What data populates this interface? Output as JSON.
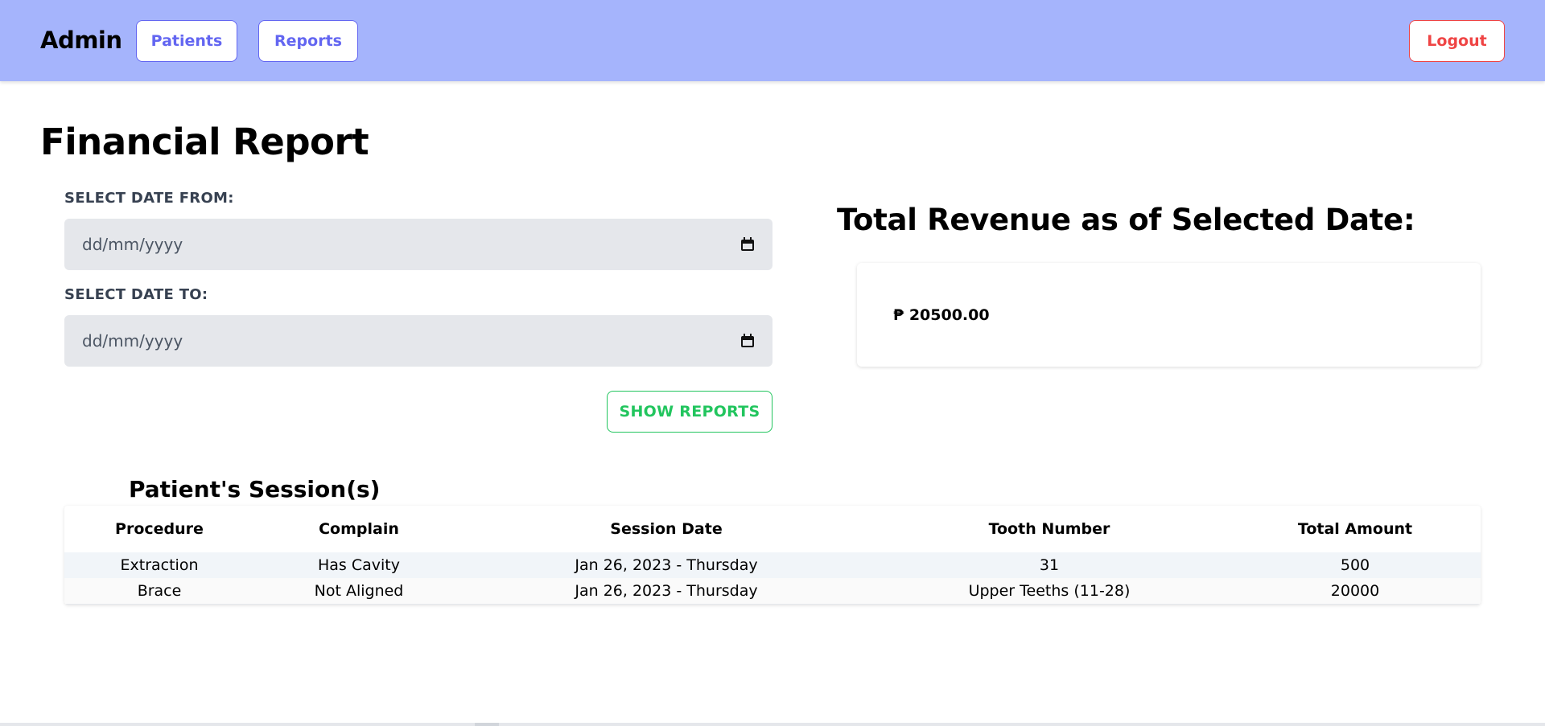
{
  "navbar": {
    "brand": "Admin",
    "patients_label": "Patients",
    "reports_label": "Reports",
    "logout_label": "Logout"
  },
  "page": {
    "title": "Financial Report"
  },
  "filters": {
    "from_label": "SELECT DATE FROM:",
    "from_placeholder": "dd/mm/yyyy",
    "to_label": "SELECT DATE TO:",
    "to_placeholder": "dd/mm/yyyy",
    "show_button": "SHOW REPORTS"
  },
  "revenue": {
    "title": "Total Revenue as of Selected Date:",
    "value": "₱ 20500.00"
  },
  "sessions": {
    "title": "Patient's Session(s)",
    "columns": [
      "Procedure",
      "Complain",
      "Session Date",
      "Tooth Number",
      "Total Amount"
    ],
    "rows": [
      [
        "Extraction",
        "Has Cavity",
        "Jan 26, 2023 - Thursday",
        "31",
        "500"
      ],
      [
        "Brace",
        "Not Aligned",
        "Jan 26, 2023 - Thursday",
        "Upper Teeths (11-28)",
        "20000"
      ]
    ]
  },
  "colors": {
    "navbar_bg": "#a5b4fc",
    "nav_button": "#6366f1",
    "logout": "#ef4444",
    "show_reports": "#22c55e",
    "input_bg": "#e5e7eb"
  },
  "icons": {
    "date_picker": "calendar-icon"
  }
}
